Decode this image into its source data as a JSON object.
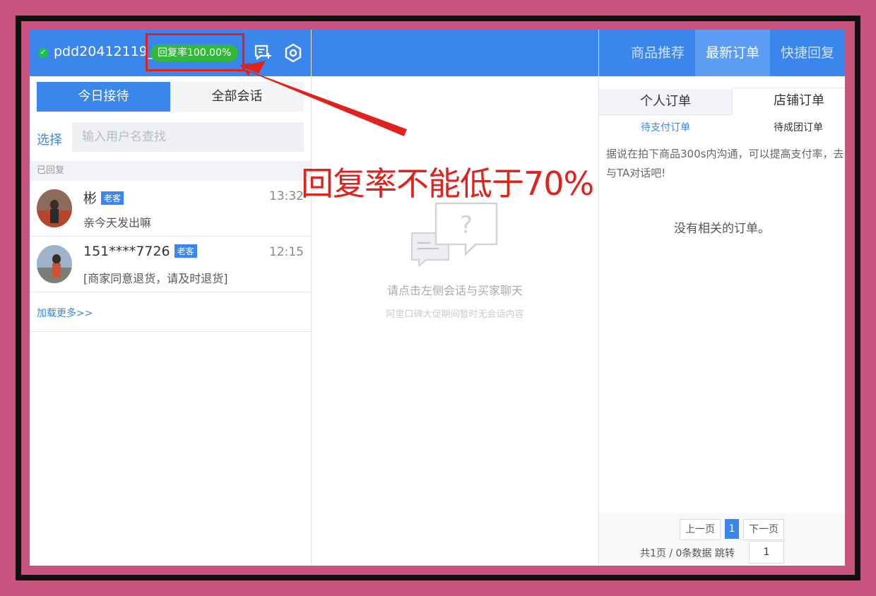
{
  "header": {
    "username": "pdd20412119_",
    "reply_rate": "回复率100.00%",
    "right_tabs": [
      "商品推荐",
      "最新订单",
      "快捷回复"
    ]
  },
  "left": {
    "tab_today": "今日接待",
    "tab_all": "全部会话",
    "select_label": "选择",
    "search_placeholder": "输入用户名查找",
    "section_replied": "已回复",
    "conversations": [
      {
        "name": "彬",
        "tag": "老客",
        "time": "13:32",
        "message": "亲今天发出嘛"
      },
      {
        "name": "151****7726",
        "tag": "老客",
        "time": "12:15",
        "message": "[商家同意退货，请及时退货]"
      }
    ],
    "load_more": "加载更多>>"
  },
  "center": {
    "empty_title": "请点击左侧会话与买家聊天",
    "empty_subtitle": "阿里口碑大促期间暂时无会话内容"
  },
  "right": {
    "order_tabs": [
      "个人订单",
      "店铺订单"
    ],
    "sub_tabs": [
      "待支付订单",
      "待成团订单"
    ],
    "notice": "据说在拍下商品300s内沟通，可以提高支付率，去与TA对话吧!",
    "empty_orders": "没有相关的订单。",
    "pagination": {
      "prev": "上一页",
      "current": "1",
      "next": "下一页",
      "info": "共1页 / 0条数据 跳转",
      "goto_value": "1"
    }
  },
  "annotation": {
    "text": "回复率不能低于70%"
  },
  "colors": {
    "primary": "#3a86ec",
    "badge_green": "#33b93a",
    "annotation_red": "#e0221c",
    "border_pink": "#c8547f"
  }
}
